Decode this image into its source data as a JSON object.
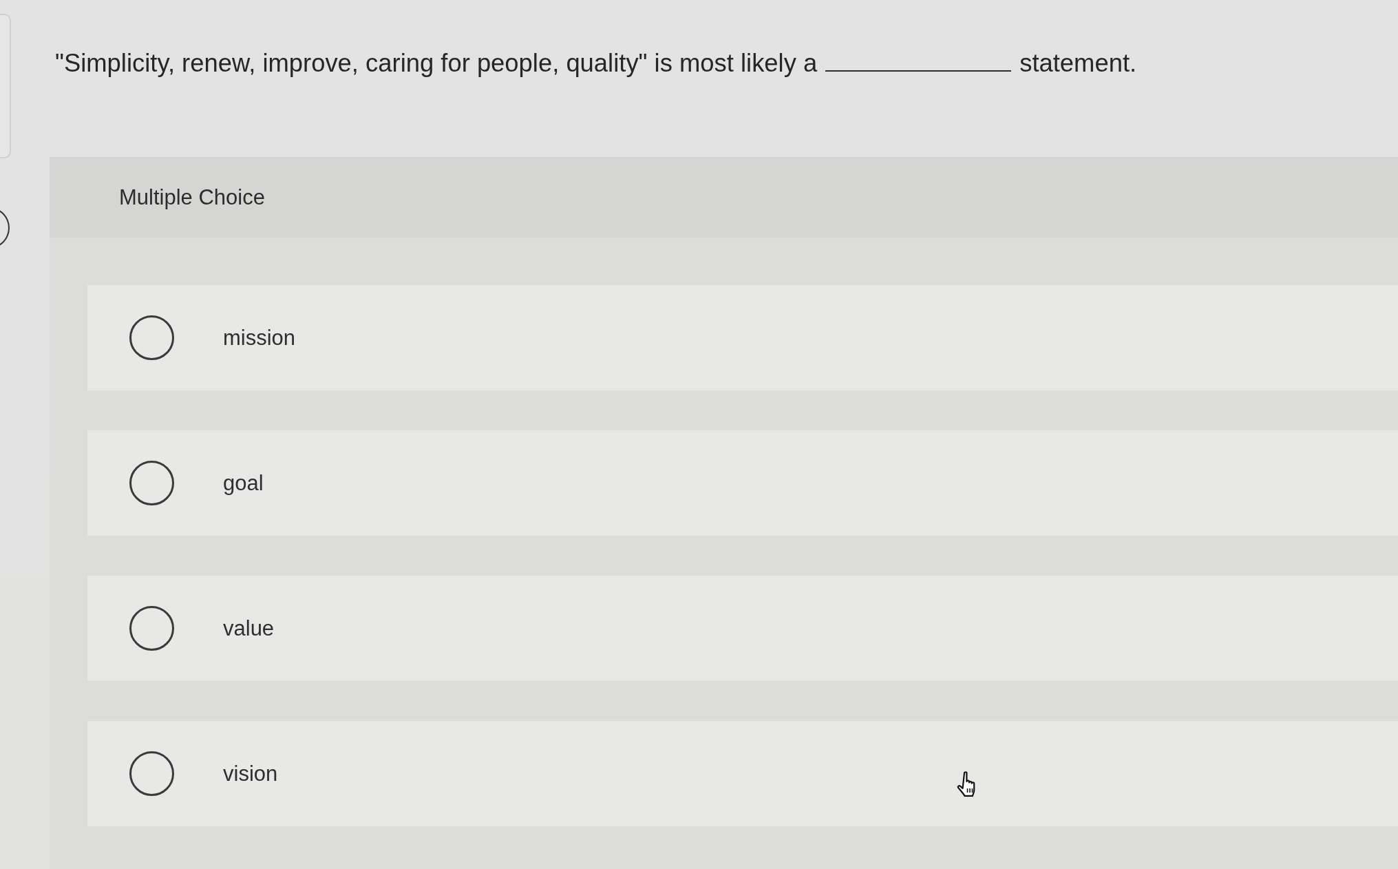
{
  "question": {
    "parts": [
      {
        "kind": "text",
        "text": "\"Simplicity, renew, improve, caring for people, quality\" is most likely a"
      },
      {
        "kind": "blank"
      },
      {
        "kind": "text",
        "text": "statement."
      }
    ]
  },
  "answer_panel": {
    "heading": "Multiple Choice",
    "options": [
      {
        "label": "mission",
        "selected": false
      },
      {
        "label": "goal",
        "selected": false
      },
      {
        "label": "value",
        "selected": false
      },
      {
        "label": "vision",
        "selected": false
      }
    ]
  }
}
